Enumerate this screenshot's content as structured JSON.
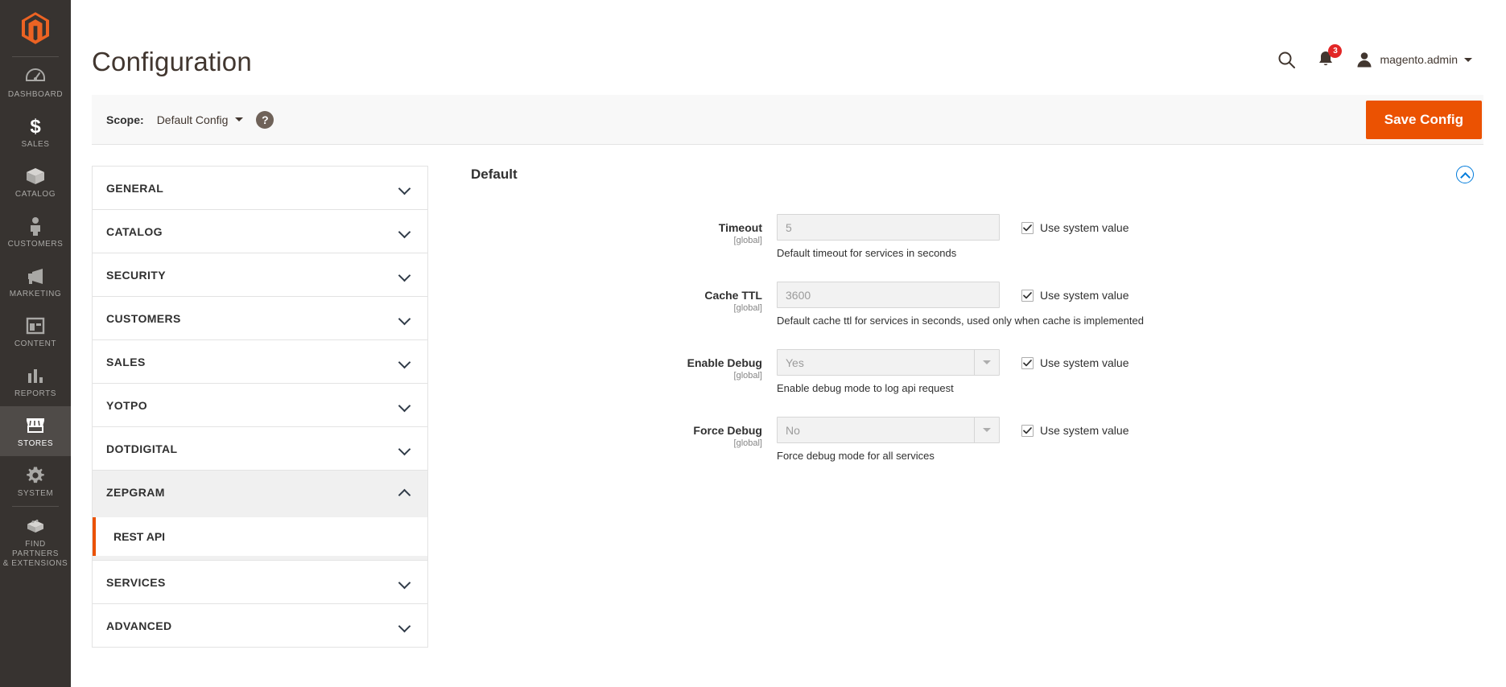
{
  "colors": {
    "brand_orange": "#eb5202",
    "nav_bg": "#373330",
    "nav_active": "#4f4b48",
    "badge_red": "#e22626",
    "link_blue": "#007bdb"
  },
  "nav": {
    "logo_alt": "magento-logo",
    "items": [
      {
        "label": "DASHBOARD",
        "icon": "dashboard-icon",
        "active": false
      },
      {
        "label": "SALES",
        "icon": "dollar-icon",
        "active": false
      },
      {
        "label": "CATALOG",
        "icon": "box-icon",
        "active": false
      },
      {
        "label": "CUSTOMERS",
        "icon": "person-icon",
        "active": false
      },
      {
        "label": "MARKETING",
        "icon": "megaphone-icon",
        "active": false
      },
      {
        "label": "CONTENT",
        "icon": "layout-icon",
        "active": false
      },
      {
        "label": "REPORTS",
        "icon": "bar-chart-icon",
        "active": false
      },
      {
        "label": "STORES",
        "icon": "storefront-icon",
        "active": true
      },
      {
        "label": "SYSTEM",
        "icon": "gear-icon",
        "active": false
      },
      {
        "label": "FIND PARTNERS\n& EXTENSIONS",
        "icon": "puzzle-block-icon",
        "active": false
      }
    ],
    "find_partners_line1": "FIND PARTNERS",
    "find_partners_line2": "& EXTENSIONS"
  },
  "header": {
    "title": "Configuration",
    "search_icon": "search-icon",
    "notifications_icon": "bell-icon",
    "notifications_count": "3",
    "user_icon": "avatar-icon",
    "user_name": "magento.admin"
  },
  "scopebar": {
    "label": "Scope:",
    "selected": "Default Config",
    "help_icon": "question-mark-icon",
    "save_label": "Save Config"
  },
  "accordion": {
    "items": [
      {
        "label": "GENERAL",
        "open": false
      },
      {
        "label": "CATALOG",
        "open": false
      },
      {
        "label": "SECURITY",
        "open": false
      },
      {
        "label": "CUSTOMERS",
        "open": false
      },
      {
        "label": "SALES",
        "open": false
      },
      {
        "label": "YOTPO",
        "open": false
      },
      {
        "label": "DOTDIGITAL",
        "open": false
      },
      {
        "label": "ZEPGRAM",
        "open": true,
        "children": [
          {
            "label": "REST API",
            "selected": true
          }
        ]
      },
      {
        "label": "SERVICES",
        "open": false
      },
      {
        "label": "ADVANCED",
        "open": false
      }
    ],
    "zepgram_label": "ZEPGRAM",
    "rest_api_label": "REST API"
  },
  "section": {
    "title": "Default",
    "collapse_icon": "chevron-up-circle-icon",
    "system_value_label": "Use system value",
    "fields": [
      {
        "label": "Timeout",
        "scope": "[global]",
        "type": "text",
        "value": "5",
        "hint": "Default timeout for services in seconds",
        "use_system_value": true
      },
      {
        "label": "Cache TTL",
        "scope": "[global]",
        "type": "text",
        "value": "3600",
        "hint": "Default cache ttl for services in seconds, used only when cache is implemented",
        "use_system_value": true
      },
      {
        "label": "Enable Debug",
        "scope": "[global]",
        "type": "select",
        "value": "Yes",
        "hint": "Enable debug mode to log api request",
        "use_system_value": true
      },
      {
        "label": "Force Debug",
        "scope": "[global]",
        "type": "select",
        "value": "No",
        "hint": "Force debug mode for all services",
        "use_system_value": true
      }
    ]
  }
}
